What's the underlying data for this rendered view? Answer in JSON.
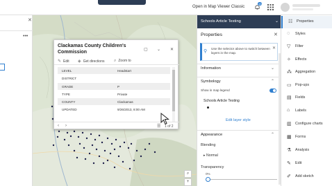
{
  "topbar": {
    "open_classic": "Open in Map Viewer Classic",
    "notification_count": "10"
  },
  "popup": {
    "title": "Clackamas County Children's Commission",
    "actions": [
      {
        "icon": "edit-icon",
        "label": "Edit"
      },
      {
        "icon": "directions-icon",
        "label": "Get directions"
      },
      {
        "icon": "zoom-icon",
        "label": "Zoom to"
      }
    ],
    "rows": [
      {
        "key": "LEVEL",
        "value": "Headstart"
      },
      {
        "key": "DISTRICT",
        "value": ""
      },
      {
        "key": "GRADE",
        "value": "P"
      },
      {
        "key": "TYPE",
        "value": "Private"
      },
      {
        "key": "COUNTY",
        "value": "Clackamas"
      },
      {
        "key": "UPDATED",
        "value": "9/26/2013, 8:00 AM"
      }
    ],
    "pager": "1 of 2"
  },
  "layer_header": {
    "title": "Schools Article Testing"
  },
  "properties": {
    "title": "Properties",
    "info_text": "Use the selector above to switch between layers in the map.",
    "information_label": "Information",
    "symbology_label": "Symbology",
    "show_legend_label": "Show in map legend",
    "show_legend_on": true,
    "layer_name": "Schools Article Testing",
    "edit_style": "Edit layer style",
    "appearance_label": "Appearance",
    "blending_label": "Blending",
    "blending_value": "Normal",
    "transparency_label": "Transparency",
    "transparency_value": "0%"
  },
  "toolbar": {
    "items": [
      {
        "icon": "properties-icon",
        "label": "Properties",
        "active": true
      },
      {
        "icon": "styles-icon",
        "label": "Styles"
      },
      {
        "icon": "filter-icon",
        "label": "Filter"
      },
      {
        "icon": "effects-icon",
        "label": "Effects"
      },
      {
        "icon": "aggregation-icon",
        "label": "Aggregation"
      },
      {
        "icon": "popups-icon",
        "label": "Pop-ups"
      },
      {
        "icon": "fields-icon",
        "label": "Fields"
      },
      {
        "icon": "labels-icon",
        "label": "Labels"
      },
      {
        "icon": "charts-icon",
        "label": "Configure charts"
      },
      {
        "icon": "forms-icon",
        "label": "Forms"
      },
      {
        "icon": "analysis-icon",
        "label": "Analysis"
      },
      {
        "icon": "edit-icon",
        "label": "Edit"
      },
      {
        "icon": "sketch-icon",
        "label": "Add sketch"
      }
    ]
  },
  "colors": {
    "header": "#2d3d55",
    "accent": "#2f7fcf",
    "map_land": "#dfe6d8",
    "point": "#1d1f4a"
  }
}
